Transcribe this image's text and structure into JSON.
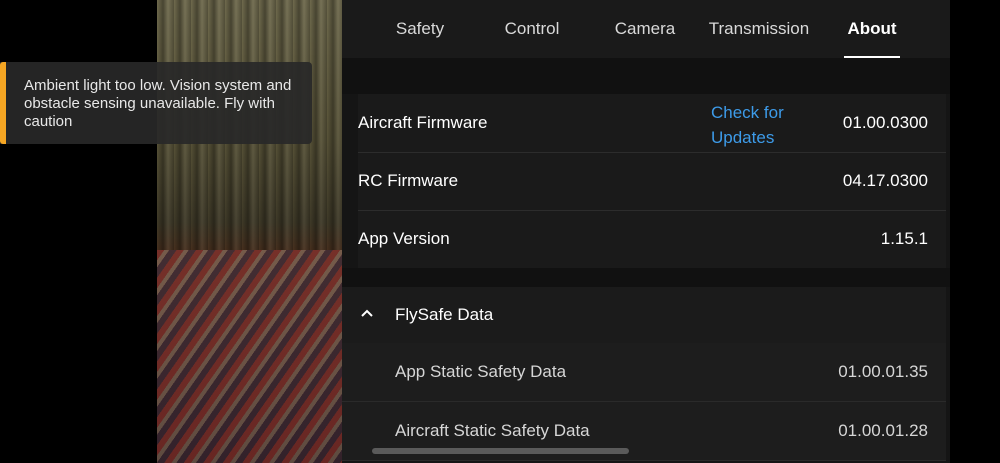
{
  "toast": {
    "message": "Ambient light too low. Vision system and obstacle sensing unavailable. Fly with caution",
    "accent_color": "#f5a623"
  },
  "tabs": [
    {
      "label": "Safety"
    },
    {
      "label": "Control"
    },
    {
      "label": "Camera"
    },
    {
      "label": "Transmission"
    },
    {
      "label": "About",
      "active": true
    }
  ],
  "about": {
    "aircraft_firmware": {
      "label": "Aircraft Firmware",
      "action": "Check for Updates",
      "value": "01.00.0300"
    },
    "rc_firmware": {
      "label": "RC Firmware",
      "value": "04.17.0300"
    },
    "app_version": {
      "label": "App Version",
      "value": "1.15.1"
    }
  },
  "flysafe": {
    "title": "FlySafe Data",
    "expanded": true,
    "items": [
      {
        "label": "App Static Safety Data",
        "value": "01.00.01.35"
      },
      {
        "label": "Aircraft Static Safety Data",
        "value": "01.00.01.28"
      }
    ]
  },
  "colors": {
    "link": "#3d9be9",
    "panel": "#151515"
  }
}
